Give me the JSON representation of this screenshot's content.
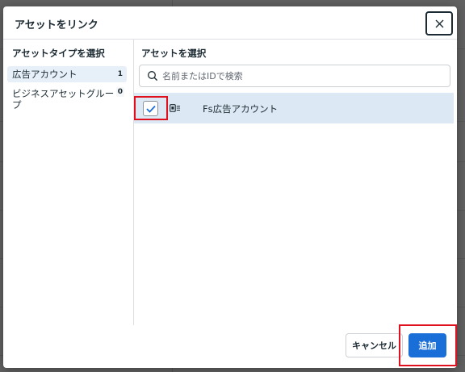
{
  "dialog": {
    "title": "アセットをリンク",
    "close_label": "×"
  },
  "left_column": {
    "heading": "アセットタイプを選択",
    "items": [
      {
        "label": "広告アカウント",
        "count": "1",
        "selected": true
      },
      {
        "label": "ビジネスアセットグループ",
        "count": "0",
        "selected": false
      }
    ]
  },
  "right_column": {
    "heading": "アセットを選択",
    "search": {
      "placeholder": "名前またはIDで検索",
      "value": ""
    },
    "assets": [
      {
        "name": "Fs広告アカウント",
        "checked": true,
        "icon": "ad-account-icon"
      }
    ]
  },
  "footer": {
    "cancel_label": "キャンセル",
    "add_label": "追加"
  },
  "colors": {
    "primary": "#1a6ed8",
    "selected_row": "#dce8f3",
    "highlight_outline": "#e0101e"
  }
}
